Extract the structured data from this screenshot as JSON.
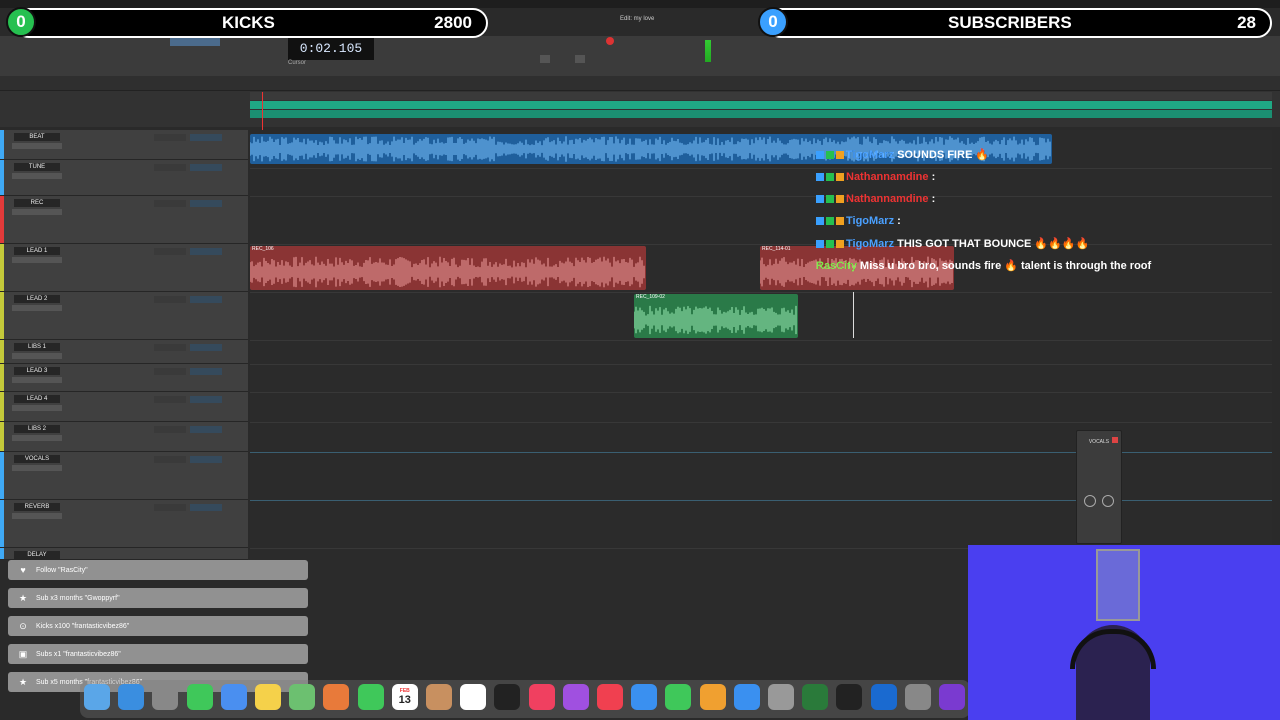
{
  "overlay": {
    "kicks_count": "0",
    "kicks_label": "KICKS",
    "kicks_goal": "2800",
    "subs_count": "0",
    "subs_label": "SUBSCRIBERS",
    "subs_goal": "28"
  },
  "transport": {
    "counter": "0:02.105",
    "session_title": "Edit: my love",
    "cursor_label": "Cursor"
  },
  "tracks": [
    {
      "name": "BEAT",
      "color": "#3fa9f5"
    },
    {
      "name": "TUNE",
      "color": "#3fa9f5"
    },
    {
      "name": "REC",
      "color": "#e23a3a"
    },
    {
      "name": "LEAD 1",
      "color": "#c4c93a"
    },
    {
      "name": "LEAD 2",
      "color": "#c4c93a"
    },
    {
      "name": "LIBS 1",
      "color": "#c4c93a"
    },
    {
      "name": "LEAD 3",
      "color": "#c4c93a"
    },
    {
      "name": "LEAD 4",
      "color": "#c4c93a"
    },
    {
      "name": "LIBS 2",
      "color": "#c4c93a"
    },
    {
      "name": "VOCALS",
      "color": "#3fa9f5"
    },
    {
      "name": "REVERB",
      "color": "#3fa9f5"
    },
    {
      "name": "DELAY",
      "color": "#3fa9f5"
    }
  ],
  "clips": {
    "rec_1": "REC_106",
    "rec_2": "REC_114-01",
    "lead2": "REC_109-02"
  },
  "chat": [
    {
      "user": "TigoMarz",
      "msg": "SOUNDS FIRE 🔥",
      "user_color": "blue"
    },
    {
      "user": "Nathannamdine",
      "msg": ":",
      "user_color": "red"
    },
    {
      "user": "Nathannamdine",
      "msg": ":",
      "user_color": "red"
    },
    {
      "user": "TigoMarz",
      "msg": ":",
      "user_color": "blue"
    },
    {
      "user": "TigoMarz",
      "msg": "THIS GOT THAT BOUNCE 🔥🔥🔥🔥",
      "user_color": "blue"
    },
    {
      "user": "RasCity",
      "msg": "Miss u bro bro, sounds fire 🔥 talent is through the roof",
      "user_color": "green"
    }
  ],
  "alerts": [
    {
      "icon": "heart-icon",
      "text": "Follow \"RasCity\""
    },
    {
      "icon": "star-icon",
      "text": "Sub x3 months \"Gwoppyrf\""
    },
    {
      "icon": "kick-icon",
      "text": "Kicks x100 \"frantasticvibez86\""
    },
    {
      "icon": "gift-icon",
      "text": "Subs x1 \"frantasticvibez86\""
    },
    {
      "icon": "star-icon",
      "text": "Sub x5 months \"frantasticvibez86\""
    }
  ],
  "dock": {
    "calendar_month": "FEB",
    "calendar_day": "13"
  },
  "plugin": {
    "title": "VOCALS"
  },
  "colors": {
    "kicks_green": "#26c050",
    "audio_clip_blue": "#2a78c8",
    "rec_clip_red": "#9a3b3b",
    "lead2_clip_green": "#2f8f54",
    "tempo_lane": "#1fa884",
    "webcam_bg": "#4a3ff0"
  }
}
